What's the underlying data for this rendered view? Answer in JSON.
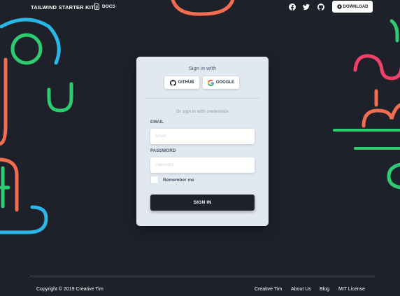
{
  "navbar": {
    "brand": "TAILWIND STARTER KIT",
    "docs_label": "DOCS",
    "social_icons": [
      "facebook-icon",
      "twitter-icon",
      "github-icon"
    ],
    "download_label": "DOWNLOAD"
  },
  "login_card": {
    "title": "Sign in with",
    "github_label": "GITHUB",
    "google_label": "GOOGLE",
    "subtitle": "Or sign in with credentials",
    "email_label": "EMAIL",
    "email_placeholder": "Email",
    "email_value": "",
    "password_label": "PASSWORD",
    "password_placeholder": "Password",
    "password_value": "",
    "remember_label": "Remember me",
    "remember_checked": false,
    "submit_label": "SIGN IN"
  },
  "footer": {
    "copyright_prefix": "Copyright © 2019 ",
    "copyright_author": "Creative Tim",
    "links": [
      "Creative Tim",
      "About Us",
      "Blog",
      "MIT License"
    ]
  },
  "colors": {
    "background": "#1e212a",
    "card": "#e2e8f0",
    "accent_blue": "#2ab7e8",
    "accent_green": "#2ecc71",
    "accent_orange": "#f26c4f",
    "accent_pink": "#f0416c"
  }
}
